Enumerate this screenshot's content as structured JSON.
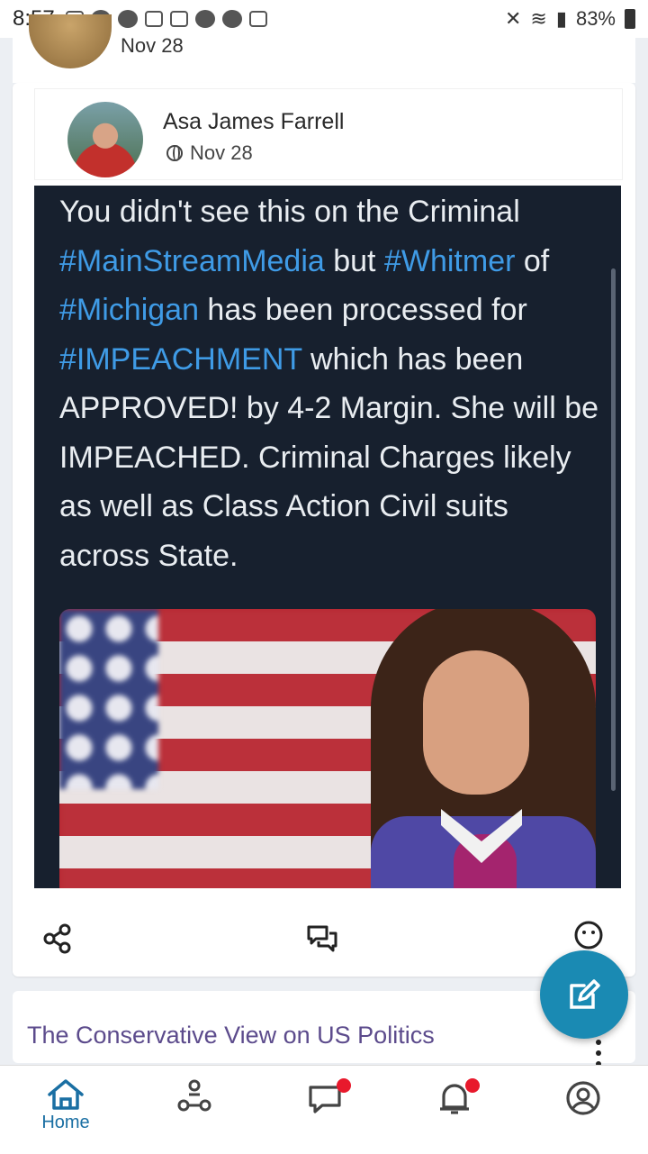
{
  "status_bar": {
    "time": "8:57",
    "battery": "83%"
  },
  "previous_post": {
    "date": "Nov 28"
  },
  "post": {
    "author": "Asa James Farrell",
    "date": "Nov 28",
    "tweet_text": {
      "p1": "You didn't see this on the Criminal",
      "tag1": "#MainStreamMedia",
      "p2": " but ",
      "tag2": "#Whitmer",
      "p3": " of",
      "tag3": "#Michigan",
      "p4": " has been processed for",
      "tag4": "#IMPEACHMENT",
      "p5": " which has been APPROVED! by 4-2 Margin. She will be IMPEACHED. Criminal Charges likely as well as Class Action Civil suits across State."
    }
  },
  "next_post": {
    "group_name": "The Conservative View on US Politics"
  },
  "bottom_nav": {
    "home_label": "Home"
  },
  "colors": {
    "accent": "#1a8ab3",
    "hashtag": "#3f9be6",
    "notification_dot": "#e8192c"
  }
}
